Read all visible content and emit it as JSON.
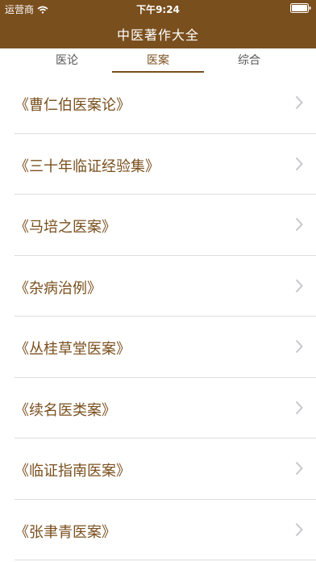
{
  "status": {
    "carrier": "运营商",
    "time": "下午9:24"
  },
  "nav": {
    "title": "中医著作大全"
  },
  "tabs": [
    {
      "label": "医论"
    },
    {
      "label": "医案"
    },
    {
      "label": "综合"
    }
  ],
  "active_tab": "医案",
  "items": [
    {
      "label": "《曹仁伯医案论》"
    },
    {
      "label": "《三十年临证经验集》"
    },
    {
      "label": "《马培之医案》"
    },
    {
      "label": "《杂病治例》"
    },
    {
      "label": "《丛桂草堂医案》"
    },
    {
      "label": "《续名医类案》"
    },
    {
      "label": "《临证指南医案》"
    },
    {
      "label": "《张聿青医案》"
    }
  ],
  "colors": {
    "brand": "#7a4f1e",
    "text_muted": "#555555",
    "divider": "#dddddd",
    "chevron": "#c7c7cc"
  },
  "icons": {
    "wifi": "wifi-icon",
    "battery": "battery-icon",
    "chevron": "chevron-right-icon"
  }
}
